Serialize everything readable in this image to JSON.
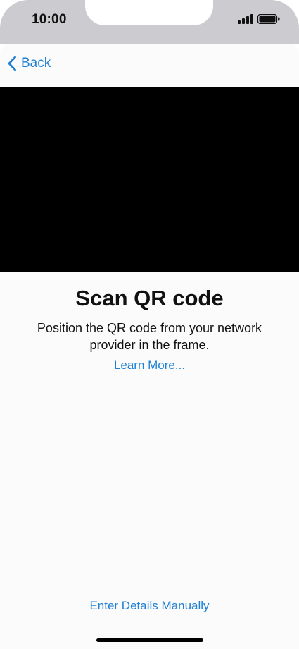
{
  "status_bar": {
    "time": "10:00",
    "signal_icon": "cellular-signal-icon",
    "battery_icon": "battery-icon"
  },
  "nav": {
    "back_label": "Back",
    "back_icon": "chevron-left-icon"
  },
  "content": {
    "title": "Scan QR code",
    "description": "Position the QR code from your network provider in the frame.",
    "learn_more": "Learn More..."
  },
  "footer": {
    "manual_entry": "Enter Details Manually"
  },
  "colors": {
    "accent": "#1f80d4",
    "status_bar_bg": "#cbcbd0",
    "sheet_bg": "#fbfbfc",
    "camera_bg": "#000000"
  }
}
